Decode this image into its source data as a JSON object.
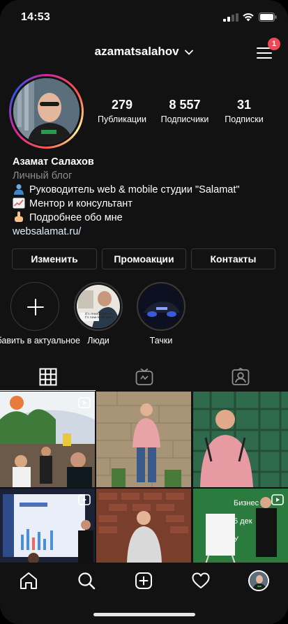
{
  "status_bar": {
    "time": "14:53"
  },
  "header": {
    "username": "azamatsalahov",
    "notification_count": "1"
  },
  "stats": [
    {
      "value": "279",
      "label": "Публикации"
    },
    {
      "value": "8 557",
      "label": "Подписчики"
    },
    {
      "value": "31",
      "label": "Подписки"
    }
  ],
  "bio": {
    "name": "Азамат Салахов",
    "category": "Личный блог",
    "line1": "Руководитель web & mobile студии \"Salamat\"",
    "line2": "Ментор и консультант",
    "line3": "Подробнее обо мне",
    "website": "websalamat.ru/"
  },
  "buttons": {
    "edit": "Изменить",
    "promo": "Промоакции",
    "contacts": "Контакты"
  },
  "highlights": [
    {
      "label": "Добавить в актуальное",
      "icon": "plus-icon"
    },
    {
      "label": "Люди"
    },
    {
      "label": "Тачки"
    }
  ],
  "highlight_cover_text": "it's meetmerrrrirh\nt's new-level gam",
  "tabs": [
    {
      "icon": "grid-icon"
    },
    {
      "icon": "igtv-icon"
    },
    {
      "icon": "tagged-icon"
    }
  ],
  "posts": [
    {
      "type": "video"
    },
    {
      "type": "photo"
    },
    {
      "type": "photo"
    },
    {
      "type": "video",
      "overlay_text": ""
    },
    {
      "type": "photo"
    },
    {
      "type": "video",
      "overlay_text": "Бизнес\n5 дек\nУ"
    }
  ],
  "nav": [
    "home-icon",
    "search-icon",
    "add-post-icon",
    "heart-icon",
    "profile-avatar"
  ],
  "colors": {
    "background": "#121212",
    "badge": "#ed4956",
    "border": "#363636",
    "muted": "#8e8e8e"
  }
}
